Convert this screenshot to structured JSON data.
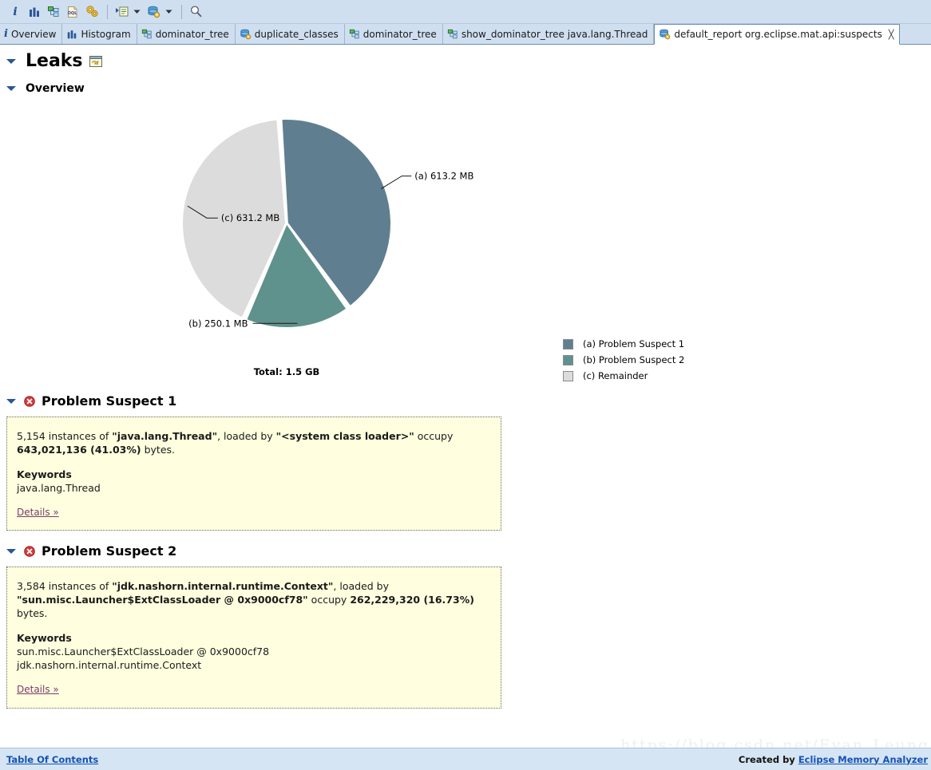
{
  "toolbar": {
    "buttons": [
      {
        "name": "overview-info-icon",
        "glyph": "i"
      },
      {
        "name": "histogram-icon",
        "glyph": "bars"
      },
      {
        "name": "dominator-tree-icon",
        "glyph": "tree"
      },
      {
        "name": "oql-icon",
        "glyph": "oql"
      },
      {
        "name": "run-expert-system-test-icon",
        "glyph": "gears"
      },
      {
        "name": "open-query-browser-icon",
        "glyph": "query"
      },
      {
        "name": "query-dropdown-arrow",
        "glyph": "caret"
      },
      {
        "name": "open-report-icon",
        "glyph": "report"
      },
      {
        "name": "report-dropdown-arrow",
        "glyph": "caret"
      },
      {
        "name": "search-icon",
        "glyph": "search"
      }
    ]
  },
  "tabs": [
    {
      "label": "Overview",
      "icon": "info-icon",
      "active": false,
      "closable": false
    },
    {
      "label": "Histogram",
      "icon": "histogram-icon",
      "active": false,
      "closable": false
    },
    {
      "label": "dominator_tree",
      "icon": "tree-icon",
      "active": false,
      "closable": false
    },
    {
      "label": "duplicate_classes",
      "icon": "report-icon",
      "active": false,
      "closable": false
    },
    {
      "label": "dominator_tree",
      "icon": "tree-icon",
      "active": false,
      "closable": false
    },
    {
      "label": "show_dominator_tree java.lang.Thread",
      "icon": "tree-icon",
      "active": false,
      "closable": false
    },
    {
      "label": "default_report  org.eclipse.mat.api:suspects",
      "icon": "report-icon",
      "active": true,
      "closable": true,
      "close_glyph": "╳"
    }
  ],
  "page": {
    "title": "Leaks",
    "section_overview": "Overview"
  },
  "chart_data": {
    "type": "pie",
    "title": "",
    "total_label": "Total: 1.5 GB",
    "total_bytes_text": "1.5 GB",
    "legend_position": "right",
    "categories": [
      "(a) Problem Suspect 1",
      "(b) Problem Suspect 2",
      "(c) Remainder"
    ],
    "labels": [
      "(a)  613.2 MB",
      "(b)  250.1 MB",
      "(c)  631.2 MB"
    ],
    "values": [
      613.2,
      250.1,
      631.2
    ],
    "unit": "MB",
    "percentages": [
      41.03,
      16.73,
      42.24
    ],
    "colors": [
      "#5f7f91",
      "#5f918d",
      "#dcdcdc"
    ],
    "legend": [
      {
        "swatch": "#5f7f91",
        "label": "(a)  Problem Suspect 1"
      },
      {
        "swatch": "#5f918d",
        "label": "(b)  Problem Suspect 2"
      },
      {
        "swatch": "#dcdcdc",
        "label": "(c)  Remainder"
      }
    ]
  },
  "suspects": [
    {
      "title": "Problem Suspect 1",
      "text_parts": [
        {
          "t": "5,154 instances of ",
          "b": false
        },
        {
          "t": "\"java.lang.Thread\"",
          "b": true
        },
        {
          "t": ", loaded by ",
          "b": false
        },
        {
          "t": "\"<system class loader>\"",
          "b": true
        },
        {
          "t": " occupy ",
          "b": false
        },
        {
          "t": "643,021,136 (41.03%)",
          "b": true
        },
        {
          "t": " bytes.",
          "b": false
        }
      ],
      "keywords_title": "Keywords",
      "keywords": [
        "java.lang.Thread"
      ],
      "details_label": "Details »"
    },
    {
      "title": "Problem Suspect 2",
      "text_parts": [
        {
          "t": "3,584 instances of ",
          "b": false
        },
        {
          "t": "\"jdk.nashorn.internal.runtime.Context\"",
          "b": true
        },
        {
          "t": ", loaded by ",
          "b": false
        },
        {
          "t": "\"sun.misc.Launcher$ExtClassLoader @ 0x9000cf78\"",
          "b": true
        },
        {
          "t": " occupy ",
          "b": false
        },
        {
          "t": "262,229,320 (16.73%)",
          "b": true
        },
        {
          "t": " bytes.",
          "b": false
        }
      ],
      "keywords_title": "Keywords",
      "keywords": [
        "sun.misc.Launcher$ExtClassLoader @ 0x9000cf78",
        "jdk.nashorn.internal.runtime.Context"
      ],
      "details_label": "Details »"
    }
  ],
  "footer": {
    "toc_label": "Table Of Contents",
    "created_by_prefix": "Created by ",
    "created_by_link": "Eclipse Memory Analyzer"
  },
  "watermark": {
    "text": "https://blog.csdn.net/Evan_Leung"
  },
  "colors": {
    "toolbar_bg": "#cfdff0",
    "footer_bg": "#d6e5f3",
    "box_bg": "#ffffdf",
    "link": "#1452b5",
    "details_link": "#7a3b6a",
    "error_red": "#d43d3d",
    "twisty_blue": "#2a5699"
  }
}
